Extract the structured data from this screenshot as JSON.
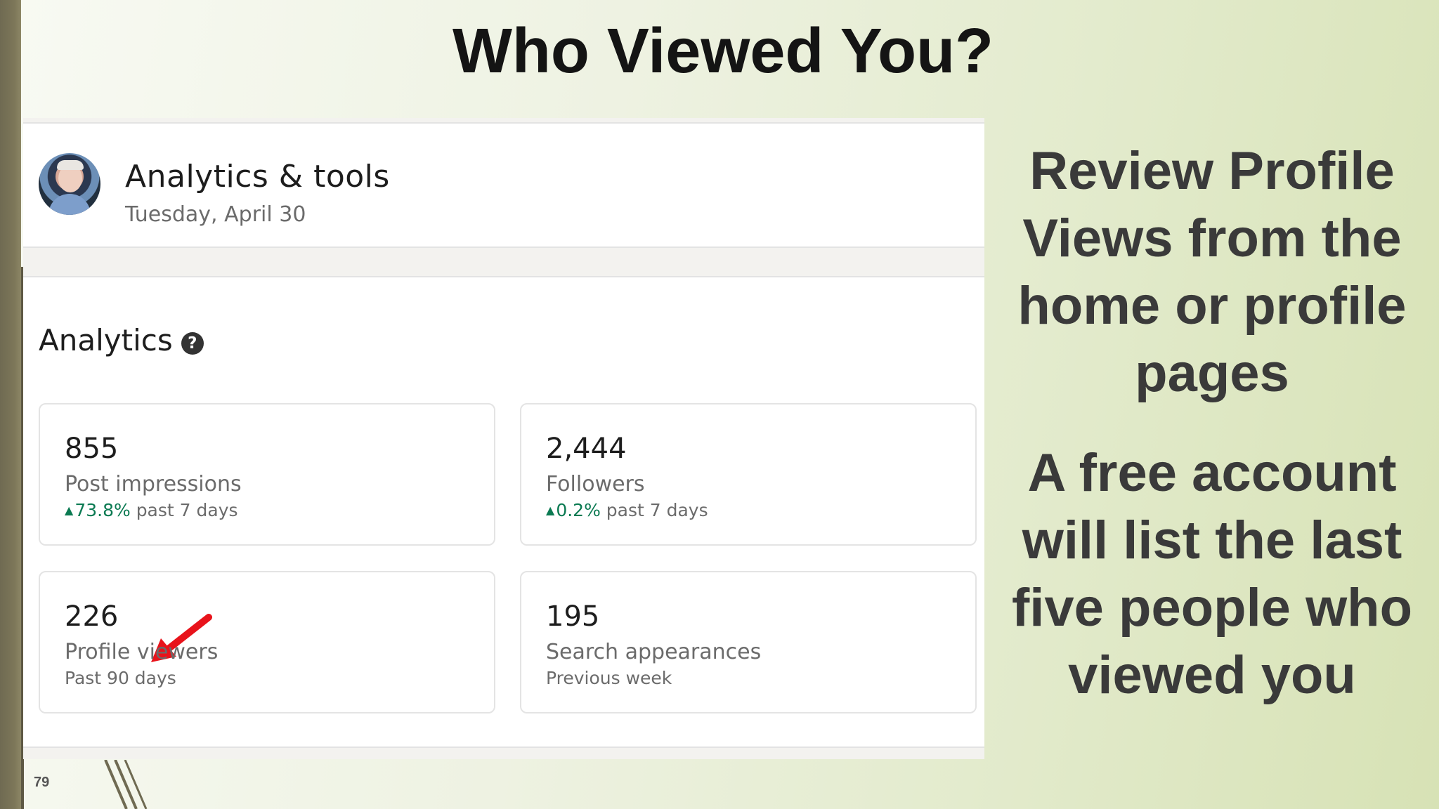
{
  "slide": {
    "title": "Who Viewed You?",
    "number": "79"
  },
  "header": {
    "title": "Analytics & tools",
    "date": "Tuesday, April 30"
  },
  "analytics": {
    "heading": "Analytics",
    "help_icon_glyph": "?",
    "cards": [
      {
        "value": "855",
        "label": "Post impressions",
        "trend_arrow": "▲",
        "trend_value": "73.8%",
        "trend_period": "past 7 days"
      },
      {
        "value": "2,444",
        "label": "Followers",
        "trend_arrow": "▲",
        "trend_value": "0.2%",
        "trend_period": "past 7 days"
      },
      {
        "value": "226",
        "label": "Profile viewers",
        "period": "Past 90 days"
      },
      {
        "value": "195",
        "label": "Search appearances",
        "period": "Previous week"
      }
    ]
  },
  "side_text": {
    "line1": "Review Profile Views from the home or profile pages",
    "line2": "A free account will list the last five people who viewed you"
  },
  "colors": {
    "trend_green": "#0b7a52",
    "annotation_arrow": "#e8131b",
    "title_text": "#141414",
    "side_text": "#3a3a3a"
  },
  "icons": {
    "help": "question-circle-icon",
    "annotation": "red-arrow-icon",
    "avatar": "profile-avatar"
  }
}
